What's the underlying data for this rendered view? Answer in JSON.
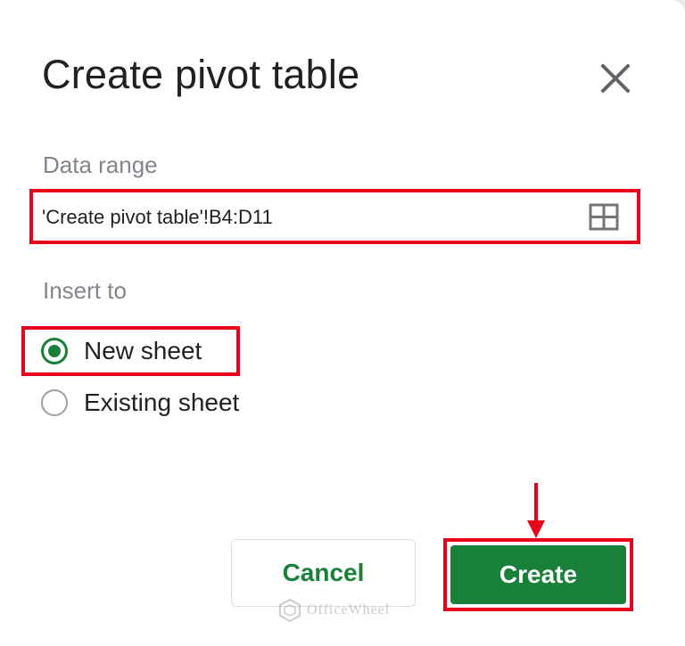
{
  "dialog": {
    "title": "Create pivot table",
    "close_icon": "close-icon"
  },
  "data_range": {
    "label": "Data range",
    "value": "'Create pivot table'!B4:D11",
    "select_icon": "grid-select-icon"
  },
  "insert_to": {
    "label": "Insert to",
    "options": [
      {
        "label": "New sheet",
        "selected": true
      },
      {
        "label": "Existing sheet",
        "selected": false
      }
    ]
  },
  "buttons": {
    "cancel_label": "Cancel",
    "create_label": "Create"
  },
  "annotations": {
    "highlight_color": "#e8001c",
    "arrow_icon": "down-arrow-icon"
  },
  "watermark": {
    "text": "OfficeWheel"
  },
  "colors": {
    "accent": "#188038",
    "title": "#202124",
    "muted": "#80868b"
  }
}
